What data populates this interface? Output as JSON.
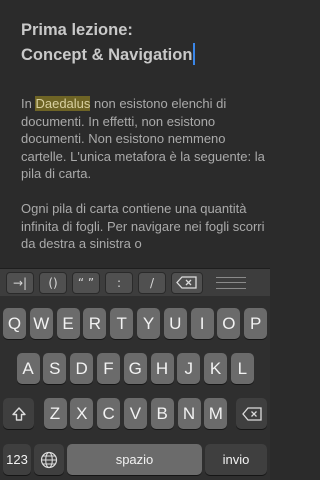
{
  "document": {
    "title_line1": "Prima lezione:",
    "title_line2": "Concept & Navigation",
    "p1_highlight": "Daedalus",
    "p1_rest": " non esistono elenchi di documenti. In effetti, non esistono documenti. Non esistono nemmeno cartelle. L'unica metafora è la seguente: la pila di carta.",
    "p1_prefix": "In ",
    "p2": "Ogni pila di carta contiene una quantità infinita di fogli. Per navigare nei fogli scorri da destra a sinistra o"
  },
  "toolbar": {
    "tab_label": "→|",
    "parens_label": "()",
    "quotes_label": "“ ”",
    "colon_label": ":",
    "slash_label": "/",
    "delete_icon": "delete-icon",
    "menu_icon": "menu-icon"
  },
  "keyboard": {
    "row1": [
      "Q",
      "W",
      "E",
      "R",
      "T",
      "Y",
      "U",
      "I",
      "O",
      "P"
    ],
    "row2": [
      "A",
      "S",
      "D",
      "F",
      "G",
      "H",
      "J",
      "K",
      "L"
    ],
    "row3": [
      "Z",
      "X",
      "C",
      "V",
      "B",
      "N",
      "M"
    ],
    "shift_icon": "shift-icon",
    "backspace_icon": "backspace-icon",
    "numbers_label": "123",
    "globe_icon": "globe-icon",
    "space_label": "spazio",
    "return_label": "invio"
  }
}
